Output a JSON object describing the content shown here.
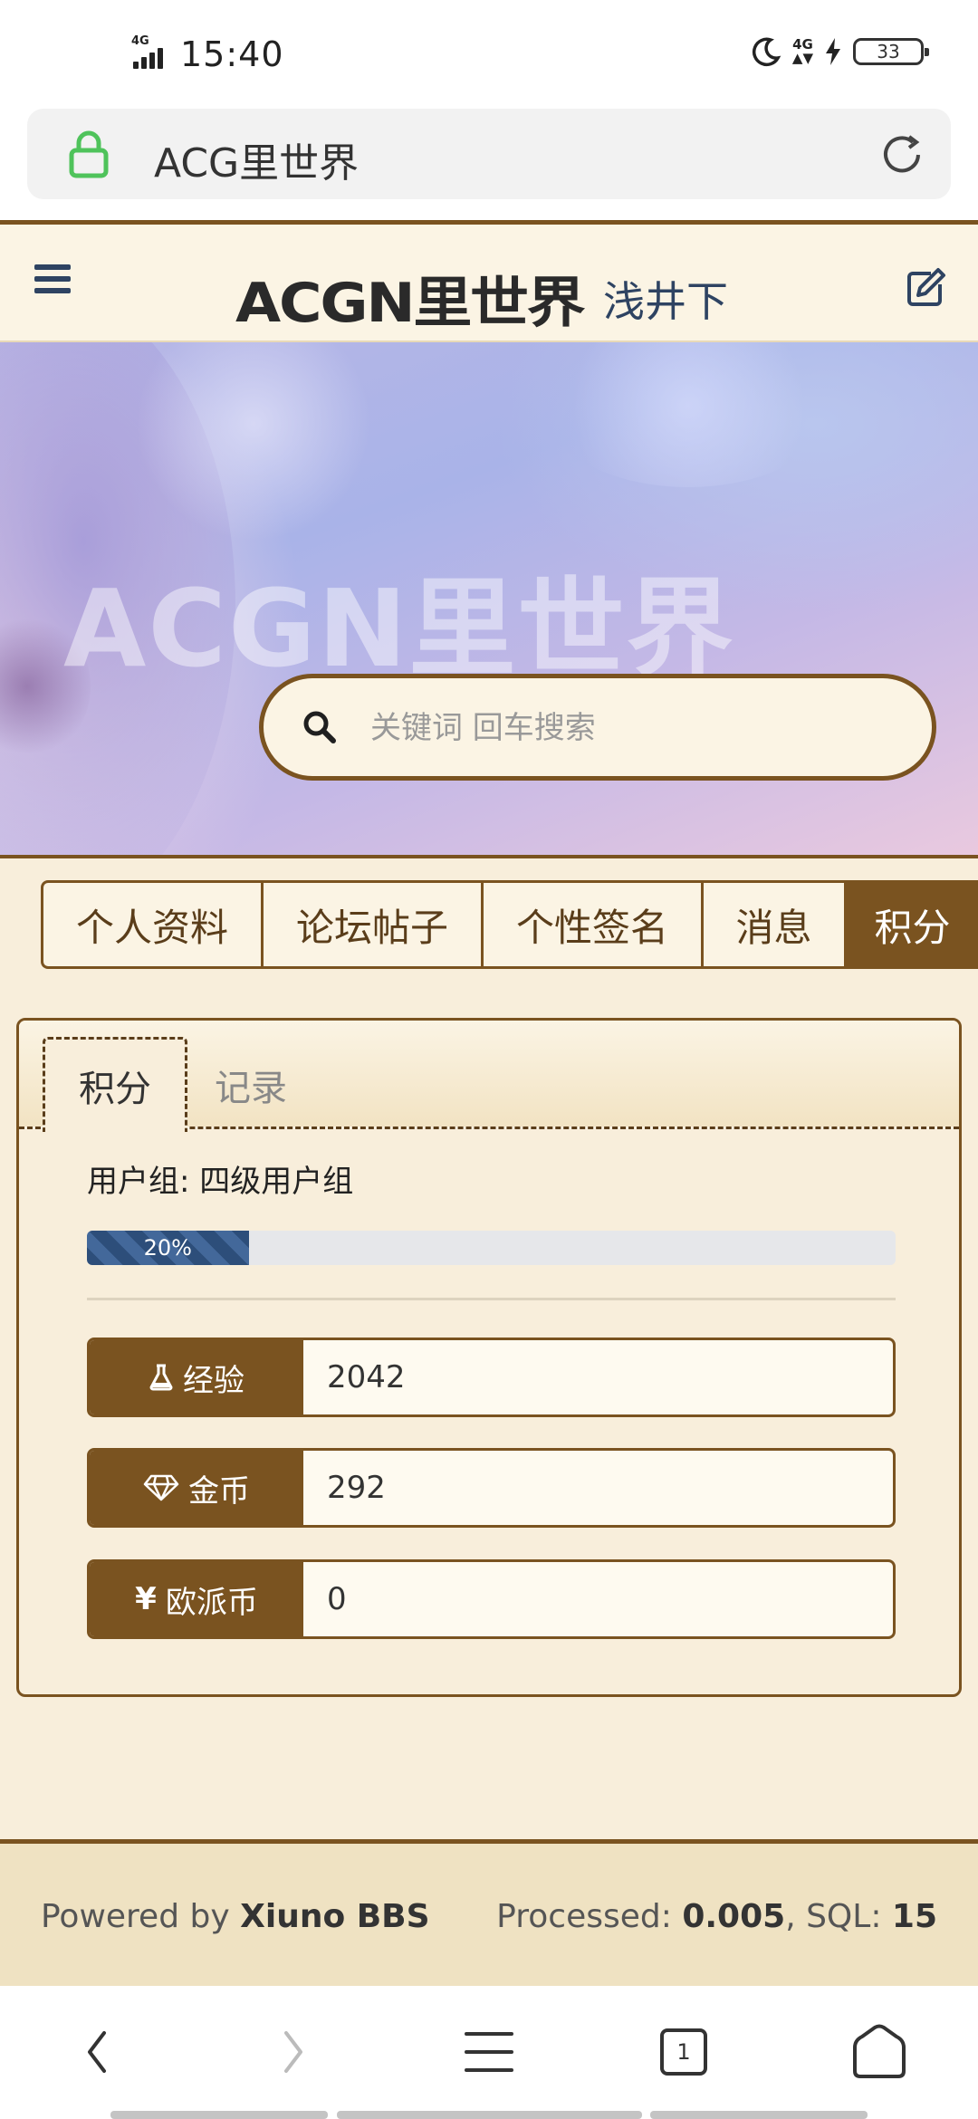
{
  "status_bar": {
    "time": "15:40",
    "network": "4G",
    "battery": "33"
  },
  "browser": {
    "url_text": "ACG里世界"
  },
  "header": {
    "logo": "ACGN里世界",
    "subtitle": "浅井下"
  },
  "banner": {
    "watermark": "ACGN里世界"
  },
  "search": {
    "placeholder": "关键词 回车搜索"
  },
  "tabs": [
    {
      "label": "个人资料",
      "active": false
    },
    {
      "label": "论坛帖子",
      "active": false
    },
    {
      "label": "个性签名",
      "active": false
    },
    {
      "label": "消息",
      "active": false
    },
    {
      "label": "积分",
      "active": true
    }
  ],
  "points_card": {
    "subtabs": [
      {
        "label": "积分",
        "active": true
      },
      {
        "label": "记录",
        "active": false
      }
    ],
    "usergroup": "用户组: 四级用户组",
    "progress_label": "20%",
    "progress_value": 0.2,
    "fields": [
      {
        "icon": "flask-icon",
        "label": "经验",
        "value": "2042"
      },
      {
        "icon": "diamond-icon",
        "label": "金币",
        "value": "292"
      },
      {
        "icon": "yen-icon",
        "label": "欧派币",
        "value": "0"
      }
    ]
  },
  "footer": {
    "powered_prefix": "Powered by ",
    "powered_name": "Xiuno BBS",
    "processed_prefix": "Processed: ",
    "processed_value": "0.005",
    "sql_prefix": ", SQL: ",
    "sql_value": "15"
  },
  "bottom_nav": {
    "tabs_count": "1"
  },
  "colors": {
    "brand_brown": "#7a5320",
    "nav_blue": "#2e4362",
    "header_bg": "#fbf4e4",
    "page_bg": "#f8eedb"
  }
}
